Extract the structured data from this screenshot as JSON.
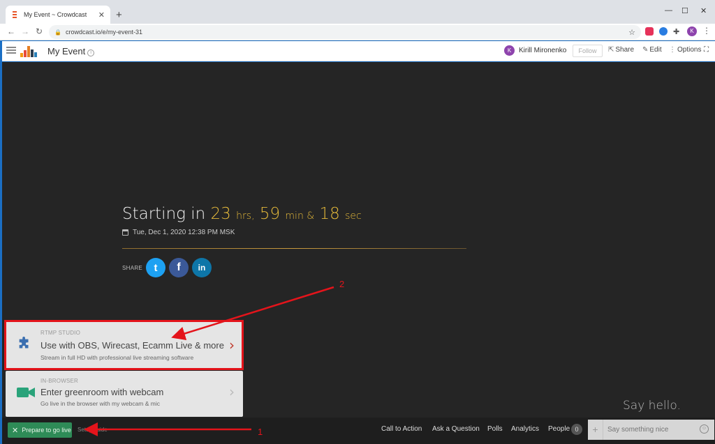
{
  "browser": {
    "tab_title": "My Event ~ Crowdcast",
    "tab_close": "✕",
    "new_tab": "+",
    "url": "crowdcast.io/e/my-event-31",
    "profile_initial": "K",
    "window_controls": {
      "minimize": "—",
      "maximize": "☐",
      "close": "✕"
    }
  },
  "header": {
    "event_title": "My Event",
    "user_initial": "K",
    "user_name": "Kirill Mironenko",
    "follow_label": "Follow",
    "share_label": "Share",
    "edit_label": "Edit",
    "options_label": "Options"
  },
  "countdown": {
    "prefix": "Starting in",
    "hours": "23",
    "hours_unit": "hrs,",
    "minutes": "59",
    "minutes_unit": "min &",
    "seconds": "18",
    "seconds_unit": "sec",
    "date": "Tue, Dec 1, 2020 12:38 PM MSK"
  },
  "share": {
    "label": "SHARE",
    "twitter_glyph": "t",
    "facebook_glyph": "f",
    "linkedin_glyph": "in"
  },
  "options": [
    {
      "kind": "RTMP STUDIO",
      "title": "Use with OBS, Wirecast, Ecamm Live & more",
      "subtitle": "Stream in full HD with professional live streaming software"
    },
    {
      "kind": "IN-BROWSER",
      "title": "Enter greenroom with webcam",
      "subtitle": "Go live in the browser with my webcam & mic"
    }
  ],
  "say_hello": "Say hello.",
  "bottombar": {
    "prepare_label": "Prepare to go live",
    "setup_label": "Setup guide",
    "links": [
      "Call to Action",
      "Ask a Question",
      "Polls",
      "Analytics",
      "People"
    ],
    "people_count": "0",
    "chat_placeholder": "Say something nice"
  },
  "annotations": {
    "label_1": "1",
    "label_2": "2"
  },
  "colors": {
    "accent_gold": "#e4b93a",
    "go_live_green": "#2e8b57",
    "highlight_red": "#e4141b",
    "twitter": "#1da1f2",
    "facebook": "#3b5998",
    "linkedin": "#0e76a8"
  },
  "icons": [
    "hamburger-icon",
    "info-icon",
    "share-icon",
    "edit-icon",
    "options-icon",
    "fullscreen-icon",
    "calendar-icon",
    "puzzle-icon",
    "camera-icon",
    "chevron-right-icon",
    "close-icon",
    "plus-icon",
    "smiley-icon"
  ]
}
